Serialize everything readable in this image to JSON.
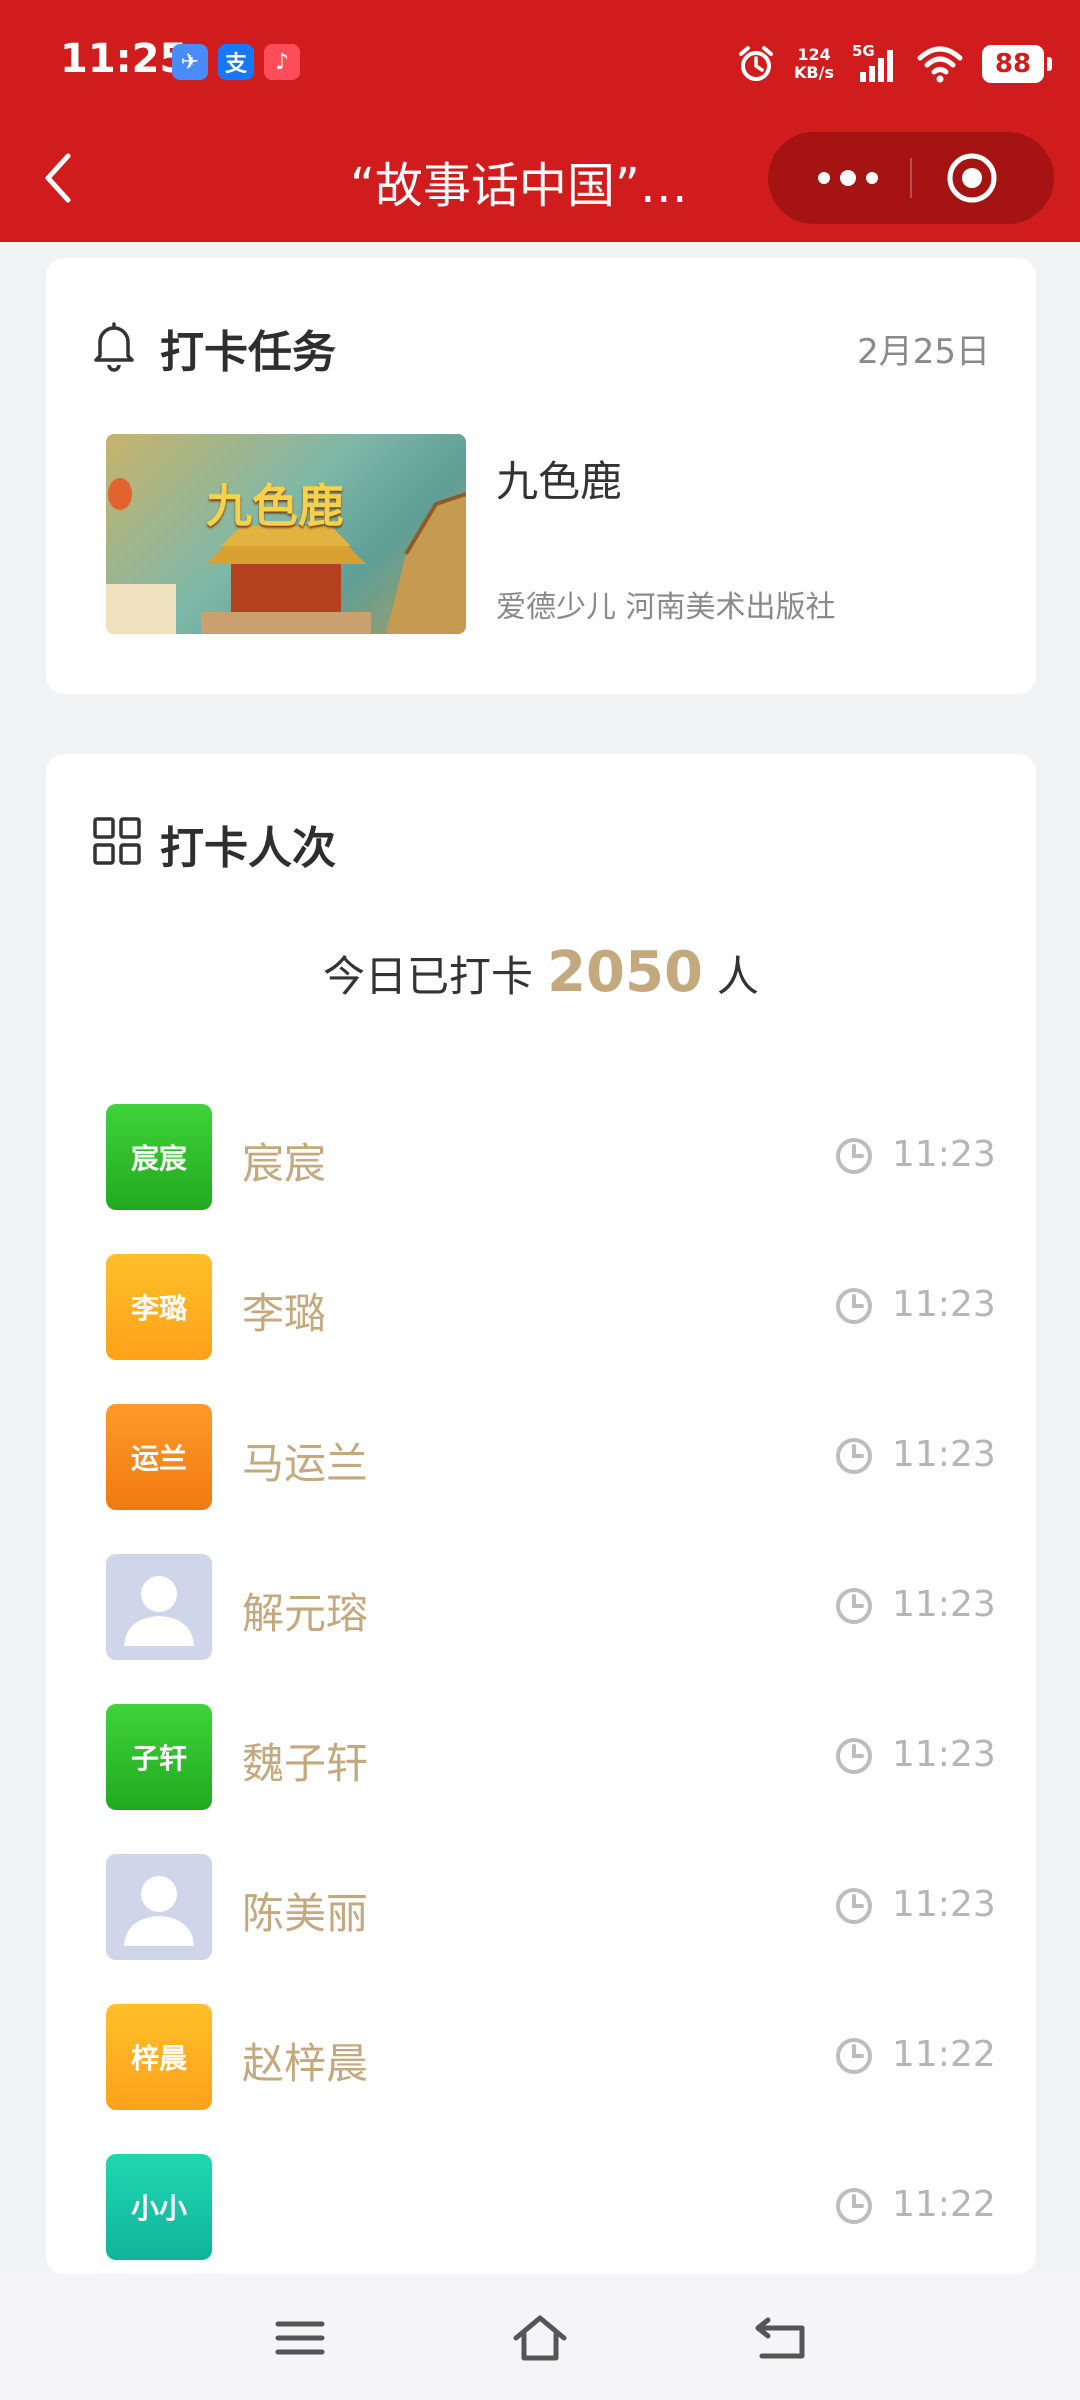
{
  "status_bar": {
    "time": "11:25",
    "net_speed_value": "124",
    "net_speed_unit": "KB/s",
    "network": "5G",
    "battery": "88",
    "app_badges": [
      {
        "label": "✈",
        "bg": "#4a8cff"
      },
      {
        "label": "支",
        "bg": "#1677ff"
      },
      {
        "label": "♪",
        "bg": "#ff4d5a"
      }
    ]
  },
  "navbar": {
    "title": "“故事话中国”…"
  },
  "task_card": {
    "title": "打卡任务",
    "date": "2月25日",
    "book": {
      "cover_title": "九色鹿",
      "name": "九色鹿",
      "meta": "爱德少儿 河南美术出版社"
    }
  },
  "checkin_card": {
    "title": "打卡人次",
    "today_prefix": "今日已打卡",
    "today_count": "2050",
    "today_suffix": "人",
    "records": [
      {
        "avatar_text": "宸宸",
        "avatar_style": "green",
        "name": "宸宸",
        "time": "11:23"
      },
      {
        "avatar_text": "李璐",
        "avatar_style": "yellow",
        "name": "李璐",
        "time": "11:23"
      },
      {
        "avatar_text": "运兰",
        "avatar_style": "orange",
        "name": "马运兰",
        "time": "11:23"
      },
      {
        "avatar_text": "",
        "avatar_style": "placeholder",
        "name": "解元瑢",
        "time": "11:23"
      },
      {
        "avatar_text": "子轩",
        "avatar_style": "green",
        "name": "魏子轩",
        "time": "11:23"
      },
      {
        "avatar_text": "",
        "avatar_style": "placeholder",
        "name": "陈美丽",
        "time": "11:23"
      },
      {
        "avatar_text": "梓晨",
        "avatar_style": "yellow",
        "name": "赵梓晨",
        "time": "11:22"
      },
      {
        "avatar_text": "小小",
        "avatar_style": "teal",
        "name": "",
        "time": "11:22"
      }
    ]
  },
  "colors": {
    "brand_red": "#d01c1c",
    "name_gold": "#c4a97f",
    "time_gray": "#b5b5b5"
  }
}
